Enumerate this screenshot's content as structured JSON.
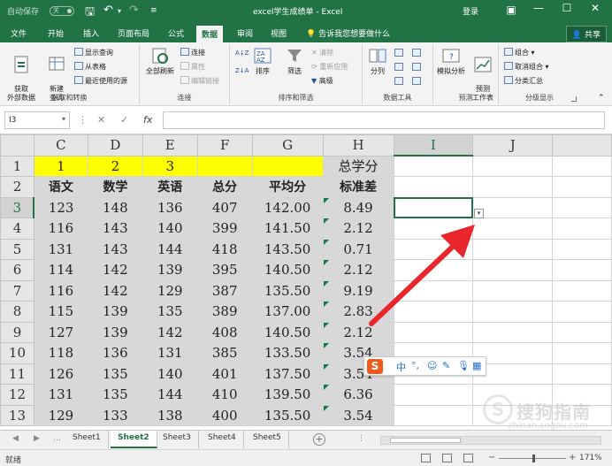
{
  "titlebar": {
    "autosave_label": "自动保存",
    "autosave_state": "关",
    "title": "excel学生成绩单 - Excel",
    "login": "登录"
  },
  "menu": {
    "tabs": [
      "文件",
      "开始",
      "插入",
      "页面布局",
      "公式",
      "数据",
      "审阅",
      "视图"
    ],
    "active": "数据",
    "tell_me": "告诉我您想要做什么",
    "share": "共享"
  },
  "ribbon": {
    "get_transform": {
      "label": "获取和转换",
      "get_external": "获取\n外部数据",
      "new_query": "新建\n查询",
      "show_queries": "显示查询",
      "from_table": "从表格",
      "recent_sources": "最近使用的源"
    },
    "connections": {
      "label": "连接",
      "refresh_all": "全部刷新",
      "connections": "连接",
      "properties": "属性",
      "edit_links": "编辑链接"
    },
    "sort_filter": {
      "label": "排序和筛选",
      "sort": "排序",
      "filter": "筛选",
      "clear": "清除",
      "reapply": "重新应用",
      "advanced": "高级"
    },
    "data_tools": {
      "label": "数据工具",
      "text_to_columns": "分列"
    },
    "forecast": {
      "label": "预测",
      "what_if": "模拟分析",
      "forecast_sheet": "预测\n工作表"
    },
    "outline": {
      "label": "分级显示",
      "group": "组合",
      "ungroup": "取消组合",
      "subtotal": "分类汇总"
    }
  },
  "formula_bar": {
    "name_box": "I3",
    "formula": ""
  },
  "grid": {
    "columns": [
      "C",
      "D",
      "E",
      "F",
      "G",
      "H",
      "I",
      "J"
    ],
    "rows": [
      {
        "num": "1",
        "cells": [
          "1",
          "2",
          "3",
          "",
          "",
          "总学分",
          "",
          ""
        ]
      },
      {
        "num": "2",
        "cells": [
          "语文",
          "数学",
          "英语",
          "总分",
          "平均分",
          "标准差",
          "",
          ""
        ]
      },
      {
        "num": "3",
        "cells": [
          "123",
          "148",
          "136",
          "407",
          "142.00",
          "8.49",
          "",
          ""
        ]
      },
      {
        "num": "4",
        "cells": [
          "116",
          "143",
          "140",
          "399",
          "141.50",
          "2.12",
          "",
          ""
        ]
      },
      {
        "num": "5",
        "cells": [
          "131",
          "143",
          "144",
          "418",
          "143.50",
          "0.71",
          "",
          ""
        ]
      },
      {
        "num": "6",
        "cells": [
          "114",
          "142",
          "139",
          "395",
          "140.50",
          "2.12",
          "",
          ""
        ]
      },
      {
        "num": "7",
        "cells": [
          "116",
          "142",
          "129",
          "387",
          "135.50",
          "9.19",
          "",
          ""
        ]
      },
      {
        "num": "8",
        "cells": [
          "115",
          "139",
          "135",
          "389",
          "137.00",
          "2.83",
          "",
          ""
        ]
      },
      {
        "num": "9",
        "cells": [
          "127",
          "139",
          "142",
          "408",
          "140.50",
          "2.12",
          "",
          ""
        ]
      },
      {
        "num": "10",
        "cells": [
          "118",
          "136",
          "131",
          "385",
          "133.50",
          "3.54",
          "",
          ""
        ]
      },
      {
        "num": "11",
        "cells": [
          "126",
          "135",
          "140",
          "401",
          "137.50",
          "3.54",
          "",
          ""
        ]
      },
      {
        "num": "12",
        "cells": [
          "131",
          "135",
          "144",
          "410",
          "139.50",
          "6.36",
          "",
          ""
        ]
      },
      {
        "num": "13",
        "cells": [
          "129",
          "133",
          "138",
          "400",
          "135.50",
          "3.54",
          "",
          ""
        ]
      }
    ],
    "active_cell": "I3"
  },
  "ime_toolbar": {
    "logo": "S",
    "mode": "中",
    "punct": "°,"
  },
  "watermark": {
    "text": "搜狗指南",
    "url": "zhinan.sogou.com"
  },
  "sheets": {
    "tabs": [
      "Sheet1",
      "Sheet2",
      "Sheet3",
      "Sheet4",
      "Sheet5"
    ],
    "active": "Sheet2"
  },
  "status": {
    "ready": "就绪",
    "zoom": "171%"
  },
  "colors": {
    "excel_green": "#217346",
    "highlight_yellow": "#ffff00",
    "column_fill_gray": "#d8d8d8",
    "annotation_arrow": "#e8262b"
  }
}
